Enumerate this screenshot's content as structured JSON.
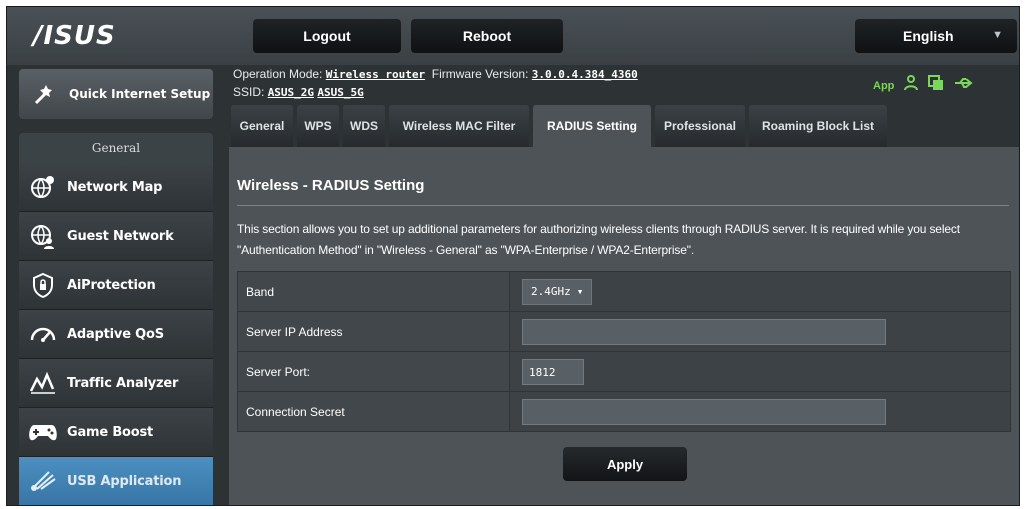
{
  "brand": {
    "logo_text": "/ISUS"
  },
  "header": {
    "logout_label": "Logout",
    "reboot_label": "Reboot",
    "language": "English"
  },
  "sidebar": {
    "quick_setup_label": "Quick Internet Setup",
    "section_label": "General",
    "items": [
      {
        "label": "Network Map",
        "icon": "network-map-icon",
        "active": false
      },
      {
        "label": "Guest Network",
        "icon": "guest-network-icon",
        "active": false
      },
      {
        "label": "AiProtection",
        "icon": "aiprotection-icon",
        "active": false
      },
      {
        "label": "Adaptive QoS",
        "icon": "adaptive-qos-icon",
        "active": false
      },
      {
        "label": "Traffic Analyzer",
        "icon": "traffic-analyzer-icon",
        "active": false
      },
      {
        "label": "Game Boost",
        "icon": "game-boost-icon",
        "active": false
      },
      {
        "label": "USB Application",
        "icon": "usb-application-icon",
        "active": true
      }
    ]
  },
  "info": {
    "operation_mode_label": "Operation Mode:",
    "operation_mode_value": "Wireless router",
    "firmware_label": "Firmware Version:",
    "firmware_value": "3.0.0.4.384_4360",
    "ssid_label": "SSID:",
    "ssid_values": [
      "ASUS_2G",
      "ASUS_5G"
    ],
    "app_label": "App",
    "status_color": "#7bd65a"
  },
  "tabs": [
    {
      "label": "General",
      "active": false
    },
    {
      "label": "WPS",
      "active": false
    },
    {
      "label": "WDS",
      "active": false
    },
    {
      "label": "Wireless MAC Filter",
      "active": false
    },
    {
      "label": "RADIUS Setting",
      "active": true
    },
    {
      "label": "Professional",
      "active": false
    },
    {
      "label": "Roaming Block List",
      "active": false
    }
  ],
  "page": {
    "title": "Wireless - RADIUS Setting",
    "description": "This section allows you to set up additional parameters for authorizing wireless clients through RADIUS server. It is required while you select \"Authentication Method\" in \"Wireless - General\" as \"WPA-Enterprise / WPA2-Enterprise\"."
  },
  "form": {
    "band_label": "Band",
    "band_value": "2.4GHz",
    "server_ip_label": "Server IP Address",
    "server_ip_value": "",
    "server_port_label": "Server Port:",
    "server_port_value": "1812",
    "secret_label": "Connection Secret",
    "secret_value": "",
    "apply_label": "Apply"
  }
}
